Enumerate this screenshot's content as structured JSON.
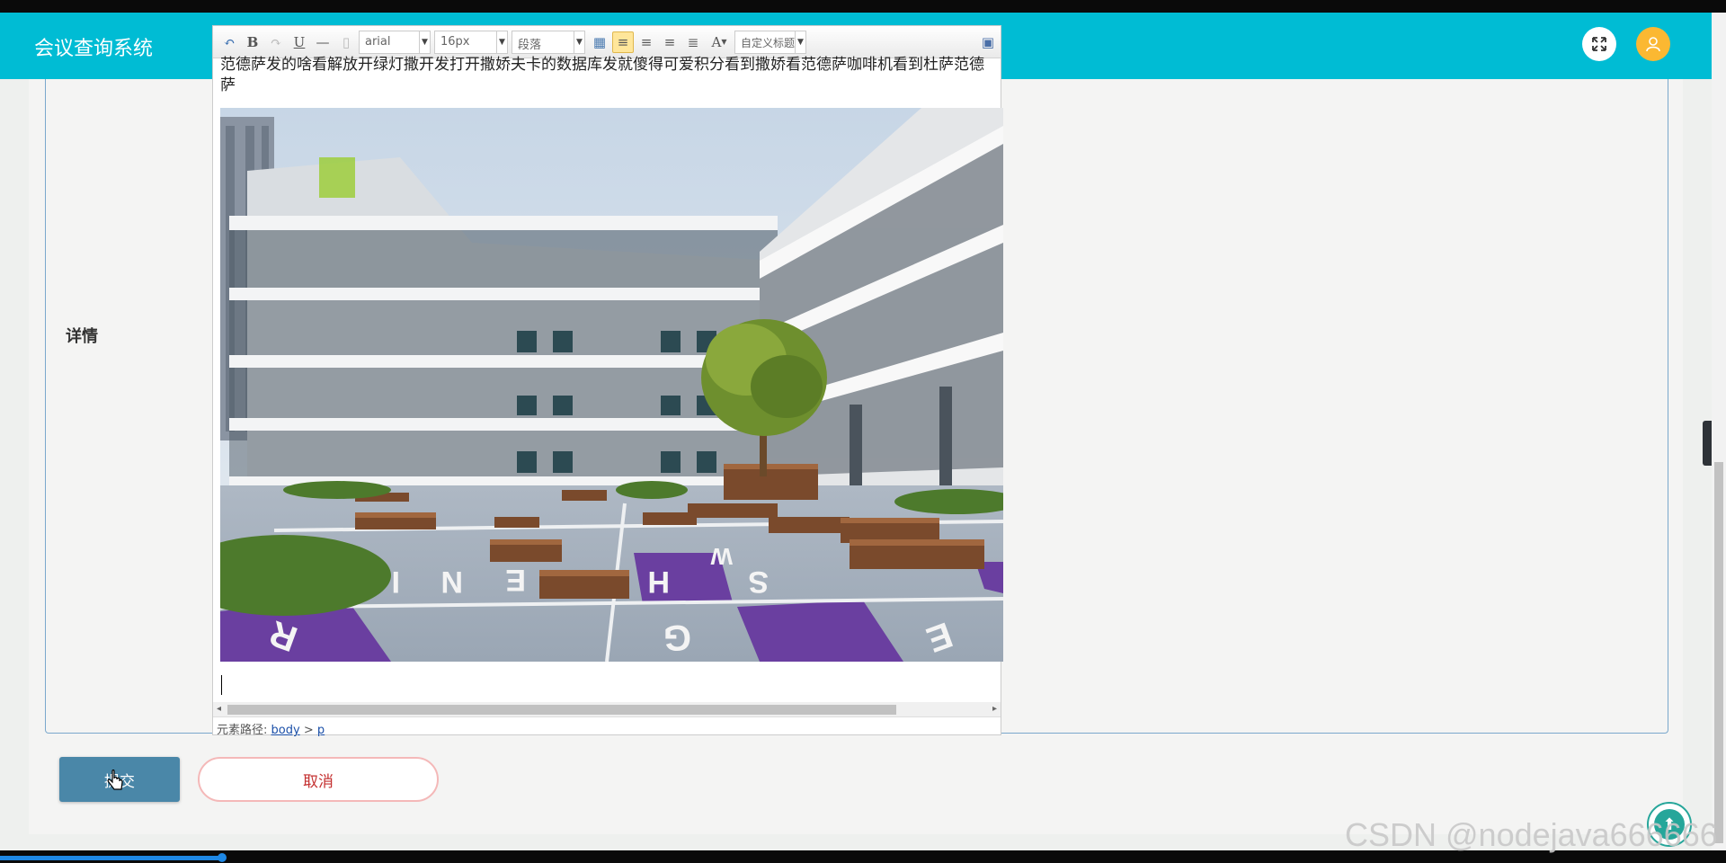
{
  "header": {
    "title": "会议查询系统",
    "fullscreen_icon": "fullscreen-icon",
    "user_icon": "user-icon"
  },
  "form": {
    "detail_label": "详情",
    "submit_label": "提交",
    "cancel_label": "取消"
  },
  "editor": {
    "toolbar": {
      "font_family": "arial",
      "font_size": "16px",
      "paragraph": "段落",
      "custom_title": "自定义标题"
    },
    "text": "范德萨发的啥看解放开绿灯撒开发打开撒娇夫卡的数据库发就傻得可爱积分看到撒娇看范德萨咖啡机看到杜萨范德萨",
    "path_label": "元素路径:",
    "path_body": "body",
    "path_sep": ">",
    "path_p": "p"
  },
  "colors": {
    "header": "#00bcd4",
    "submit": "#4a87a8",
    "cancel_text": "#c43030"
  },
  "watermark": "CSDN @nodejava666666"
}
